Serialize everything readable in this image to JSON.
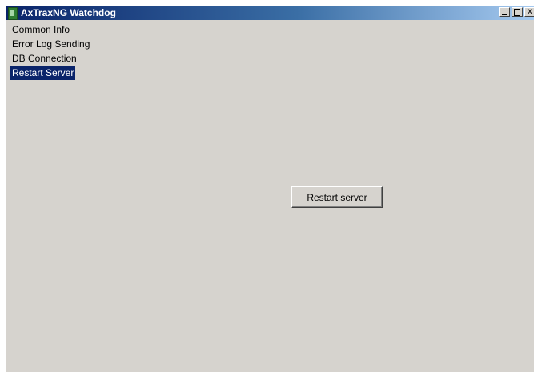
{
  "window": {
    "title": "AxTraxNG Watchdog",
    "icon": "app-icon"
  },
  "caption_buttons": {
    "minimize_icon": "minimize-icon",
    "maximize_icon": "maximize-icon",
    "close_label": "x"
  },
  "menu": {
    "items": [
      {
        "label": "Common Info",
        "selected": false
      },
      {
        "label": "Error Log Sending",
        "selected": false
      },
      {
        "label": "DB Connection",
        "selected": false
      },
      {
        "label": "Restart Server",
        "selected": true
      }
    ]
  },
  "main": {
    "restart_button_label": "Restart server"
  },
  "colors": {
    "titlebar_start": "#0a246a",
    "titlebar_end": "#a6caf0",
    "window_bg": "#d6d3ce",
    "selection_bg": "#0a246a"
  }
}
